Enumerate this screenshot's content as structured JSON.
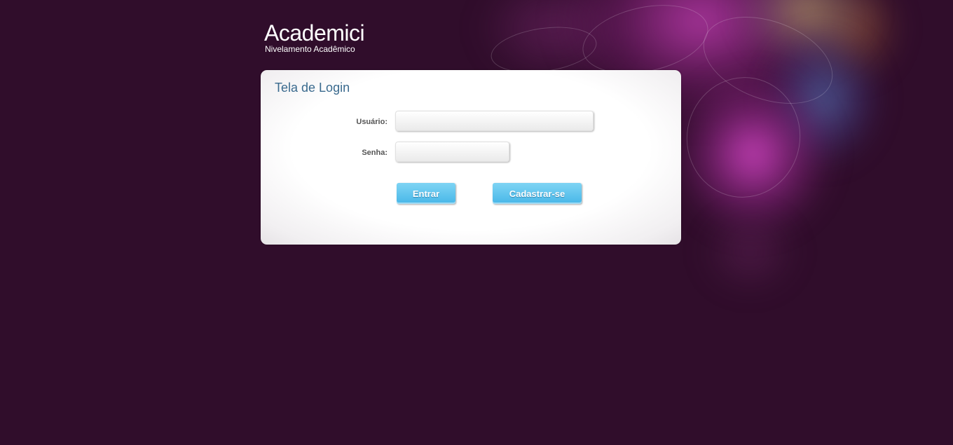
{
  "brand": {
    "title": "Academici",
    "subtitle": "Nivelamento Acadêmico"
  },
  "login": {
    "heading": "Tela de Login",
    "user_label": "Usuário:",
    "user_value": "",
    "password_label": "Senha:",
    "password_value": "",
    "enter_button": "Entrar",
    "register_button": "Cadastrar-se"
  },
  "colors": {
    "background": "#300d2b",
    "panel": "#ffffff",
    "heading": "#3a6a8e",
    "button": "#4fbde9"
  }
}
